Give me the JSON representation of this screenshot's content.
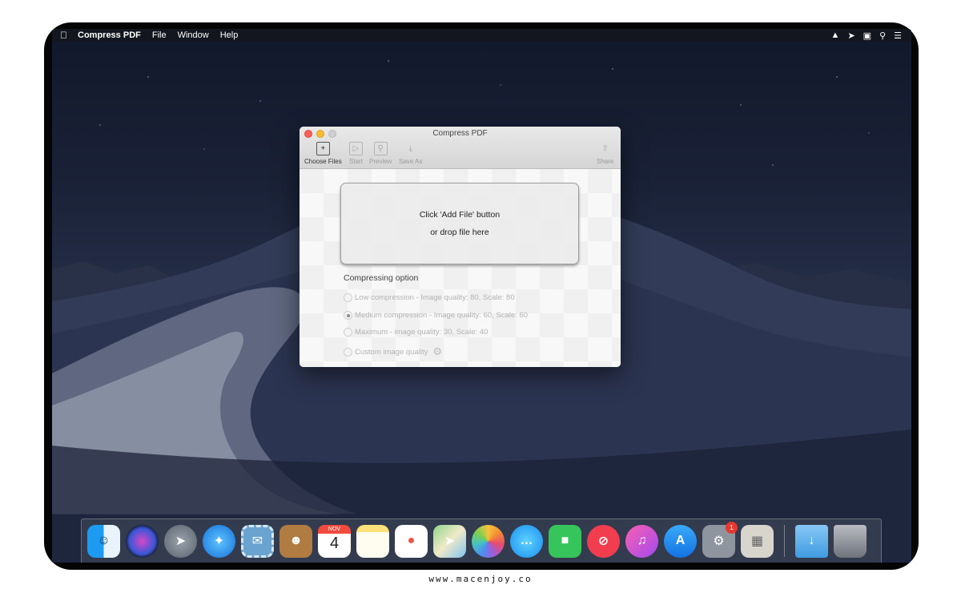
{
  "menubar": {
    "apple_icon": "apple-icon",
    "app_name": "Compress PDF",
    "items": [
      "File",
      "Window",
      "Help"
    ],
    "status_icons": [
      "notification-icon",
      "airplay-icon",
      "display-icon",
      "search-icon",
      "list-icon"
    ]
  },
  "window": {
    "title": "Compress PDF",
    "toolbar": {
      "choose_files": "Choose Files",
      "start": "Start",
      "preview": "Preview",
      "save_as": "Save As",
      "share": "Share"
    },
    "drop_zone": {
      "line1": "Click 'Add File' button",
      "line2": "or drop file here"
    },
    "options_heading": "Compressing option",
    "options": [
      {
        "label": "Low compression - Image quality: 80, Scale: 80",
        "selected": false
      },
      {
        "label": "Medium compression - Image quality: 60, Scale: 60",
        "selected": true
      },
      {
        "label": "Maximum - image quality: 30, Scale: 40",
        "selected": false
      },
      {
        "label": "Custom image quality",
        "selected": false
      }
    ]
  },
  "dock": {
    "calendar": {
      "month": "NOV",
      "day": "4"
    },
    "badge_count": "1",
    "apps": [
      "finder-icon",
      "siri-icon",
      "launchpad-icon",
      "safari-icon",
      "mail-icon",
      "contacts-icon",
      "calendar-icon",
      "notes-icon",
      "reminders-icon",
      "maps-icon",
      "photos-icon",
      "messages-icon",
      "facetime-icon",
      "news-icon",
      "itunes-icon",
      "app-store-icon",
      "system-preferences-icon",
      "compress-pdf-icon",
      "downloads-folder-icon",
      "trash-icon"
    ]
  },
  "caption": "www.macenjoy.co",
  "colors": {
    "close": "#fc5f57",
    "minimize": "#fdbc2e",
    "badge": "#e8382e"
  }
}
